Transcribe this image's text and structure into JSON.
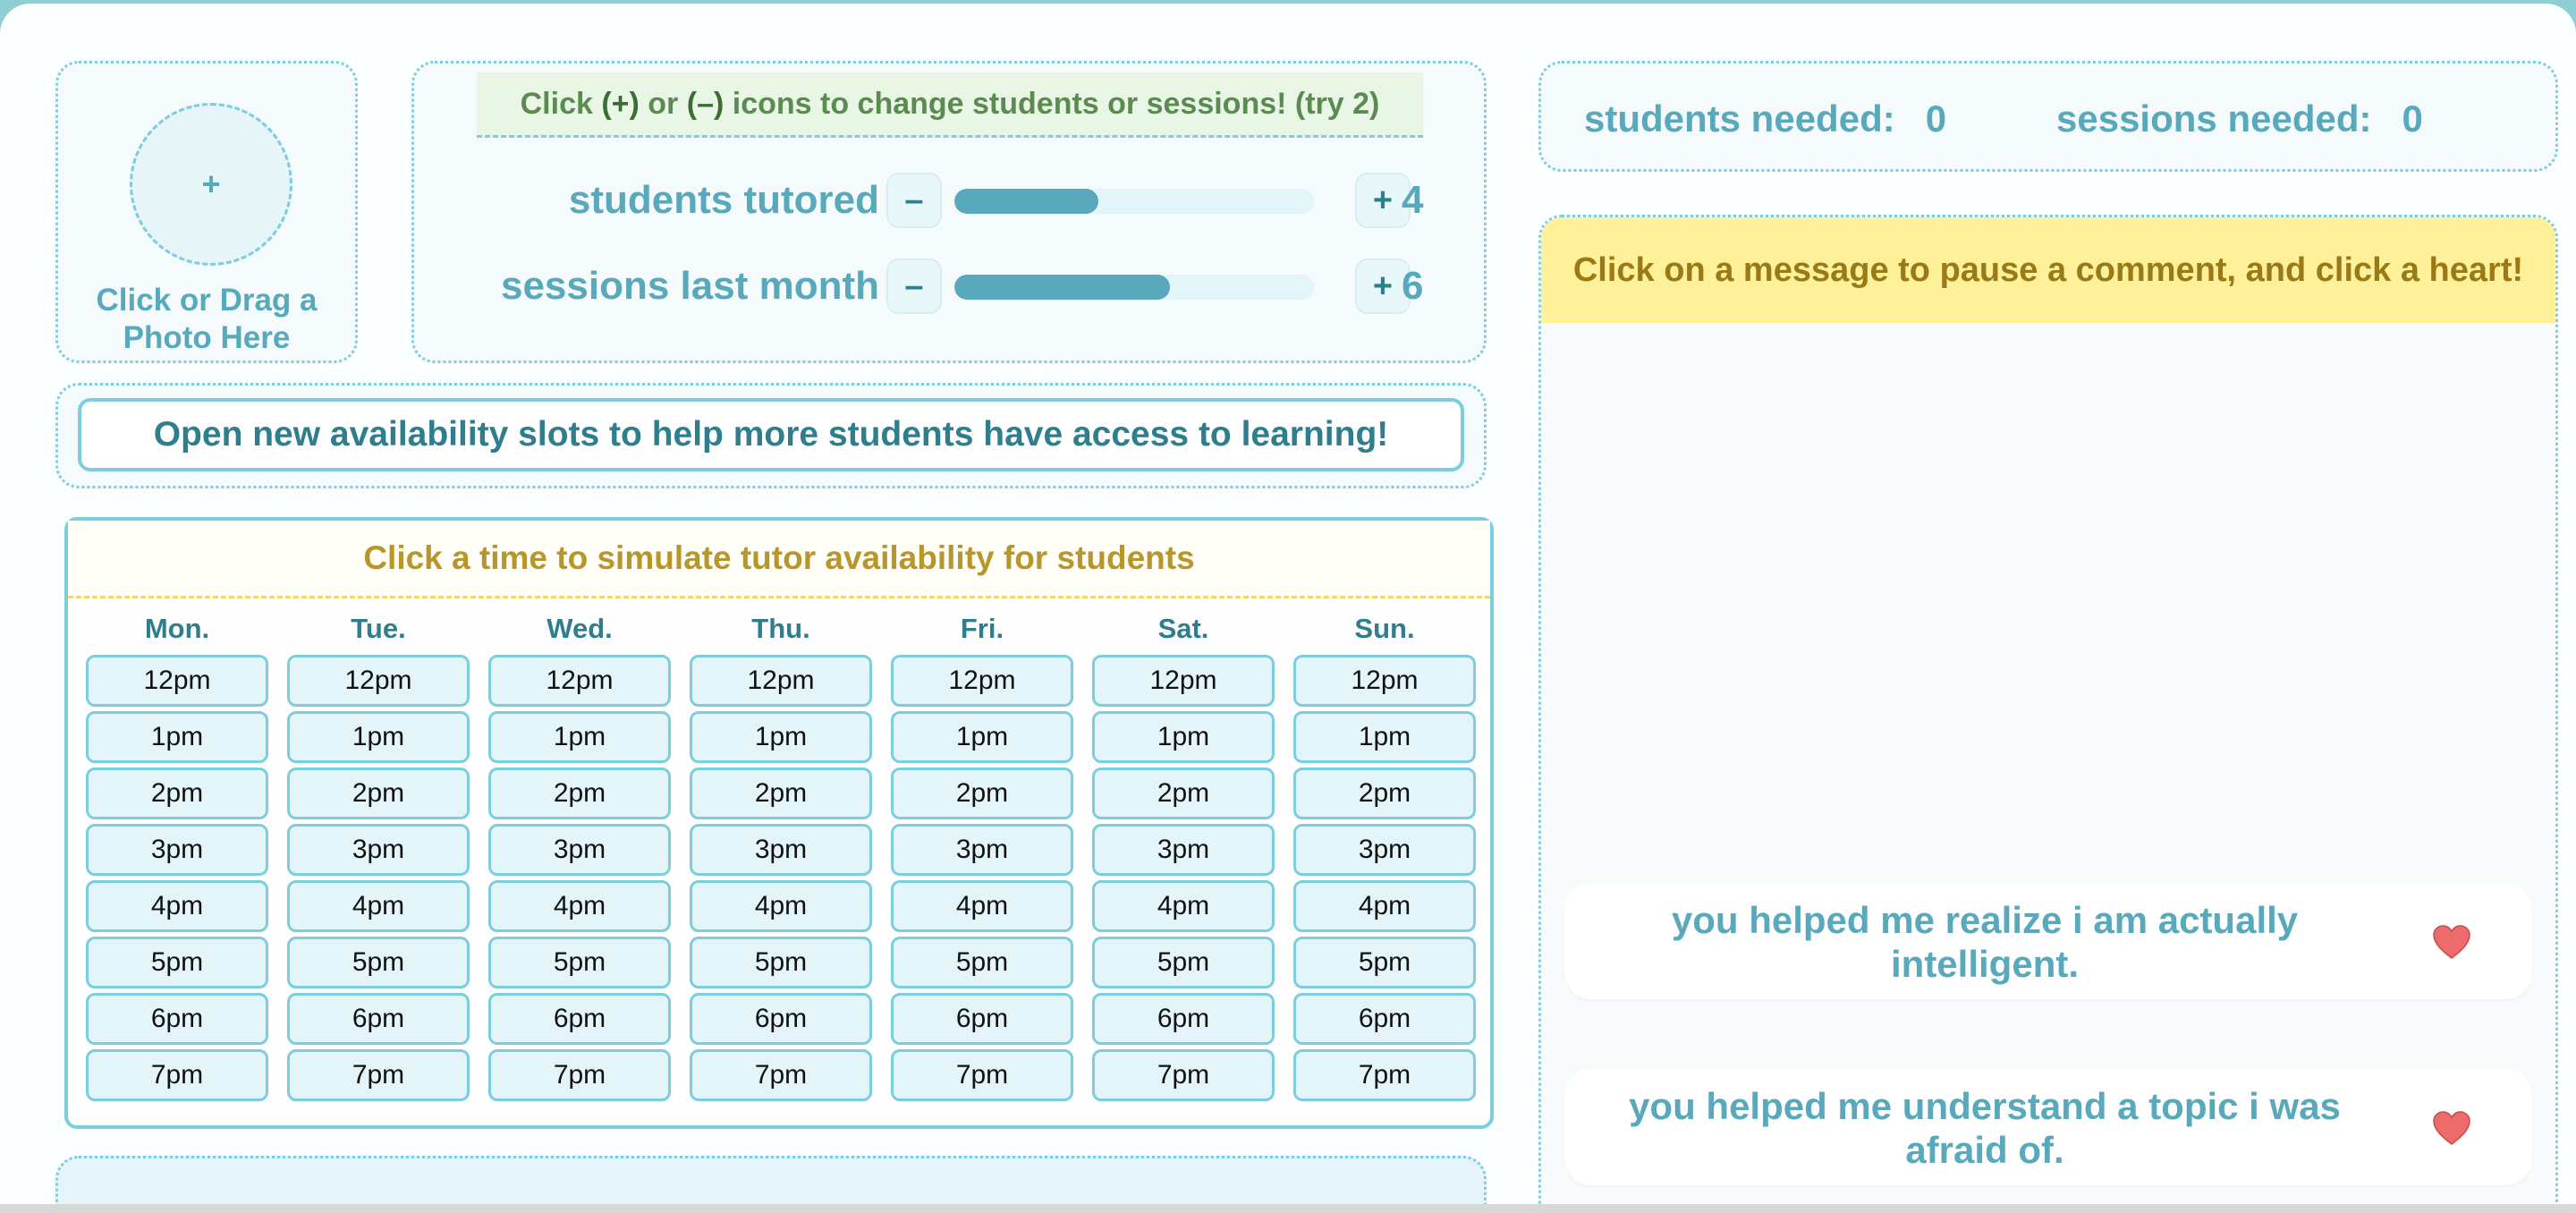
{
  "photo": {
    "plus": "+",
    "label": "Click or Drag a Photo Here"
  },
  "stats": {
    "hint_prefix": "Click ",
    "hint_plus": "(+)",
    "hint_or": " or ",
    "hint_minus": "(–)",
    "hint_suffix": " icons to change students or sessions! (try 2)",
    "rows": [
      {
        "label": "students tutored",
        "minus": "–",
        "plus": "+",
        "value": "4",
        "fill_fraction": 0.4
      },
      {
        "label": "sessions last month",
        "minus": "–",
        "plus": "+",
        "value": "6",
        "fill_fraction": 0.6
      }
    ]
  },
  "banner": {
    "text": "Open new availability slots to help more students have access to learning!"
  },
  "calendar": {
    "title": "Click a time to simulate tutor availability for students",
    "days": [
      "Mon.",
      "Tue.",
      "Wed.",
      "Thu.",
      "Fri.",
      "Sat.",
      "Sun."
    ],
    "times": [
      "12pm",
      "1pm",
      "2pm",
      "3pm",
      "4pm",
      "5pm",
      "6pm",
      "7pm"
    ]
  },
  "needed": {
    "students_label": "students needed:",
    "students_value": "0",
    "sessions_label": "sessions needed:",
    "sessions_value": "0"
  },
  "messages": {
    "hint": "Click on a message to pause a comment, and click a heart!",
    "items": [
      {
        "text": "you helped me realize i am actually intelligent.",
        "icon": "heart-icon"
      },
      {
        "text": "you helped me understand a topic i was afraid of.",
        "icon": "heart-icon"
      }
    ]
  },
  "colors": {
    "accent": "#57a9bb",
    "border": "#7ccddd",
    "hint_yellow": "#fff19a",
    "heart": "#e85a5a"
  }
}
